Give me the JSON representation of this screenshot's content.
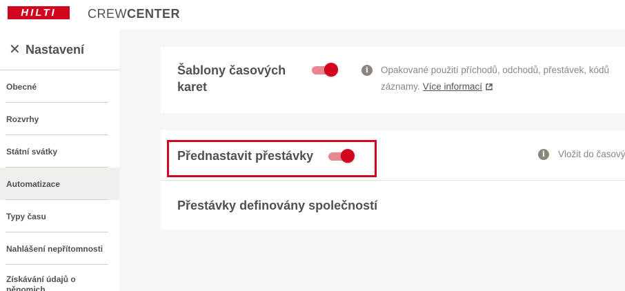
{
  "header": {
    "logo_text": "HILTI",
    "app_name_light": "CREW",
    "app_name_bold": "CENTER"
  },
  "sidebar": {
    "title": "Nastavení",
    "close_icon": "close-icon",
    "items": [
      {
        "label": "Obecné"
      },
      {
        "label": "Rozvrhy"
      },
      {
        "label": "Státní svátky"
      },
      {
        "label": "Automatizace",
        "active": true
      },
      {
        "label": "Typy času"
      },
      {
        "label": "Nahlášení nepřítomnosti"
      },
      {
        "label": "Získávání údajů o pěnomich"
      }
    ]
  },
  "settings": {
    "timecard_templates": {
      "label": "Šablony časových karet",
      "enabled": true,
      "info": "Opakované použití příchodů, odchodů, přestávek, kódů záznamy.",
      "info_line1": "Opakované použití příchodů, odchodů, přestávek, kódů",
      "info_line2": "záznamy.",
      "link": "Více informací"
    },
    "preset_breaks": {
      "label": "Přednastavit přestávky",
      "enabled": true,
      "info": "Vložit do časový"
    },
    "company_breaks": {
      "label": "Přestávky definovány společností"
    }
  },
  "colors": {
    "accent": "#d2051e",
    "toggle_track": "#e88791",
    "text": "#524f53",
    "muted": "#8b8580",
    "background": "#f5f5f4"
  }
}
